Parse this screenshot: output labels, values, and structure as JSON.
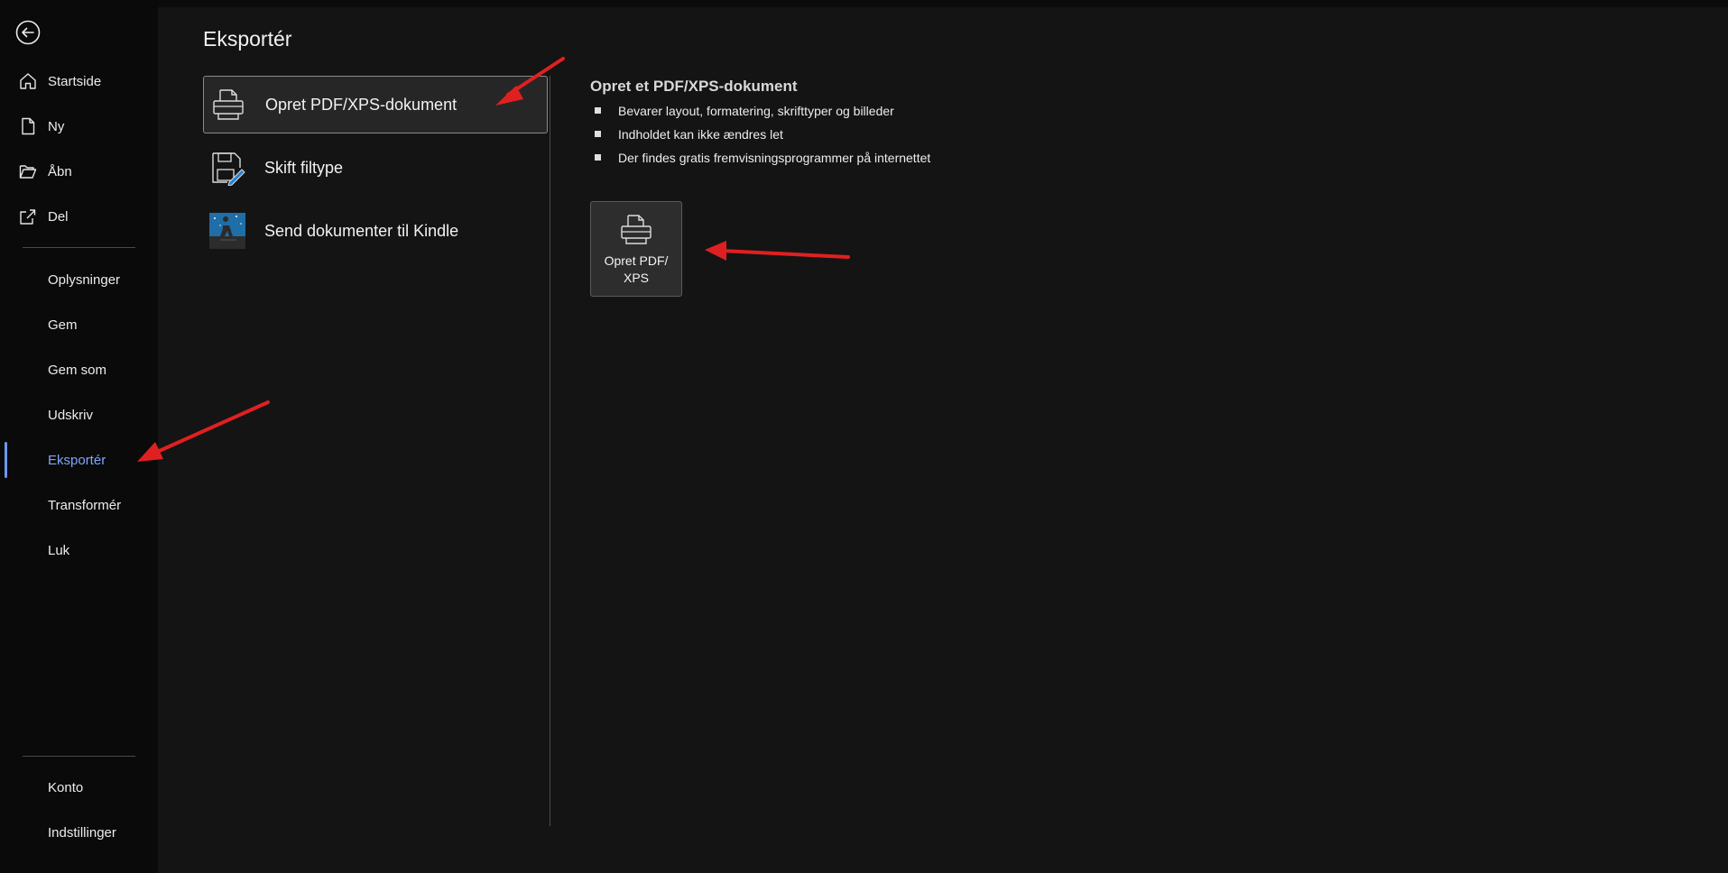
{
  "page": {
    "title": "Eksportér"
  },
  "sidebar": {
    "items": [
      {
        "label": "Startside",
        "icon": "home-icon"
      },
      {
        "label": "Ny",
        "icon": "new-document-icon"
      },
      {
        "label": "Åbn",
        "icon": "folder-open-icon"
      },
      {
        "label": "Del",
        "icon": "share-icon"
      },
      {
        "label": "Oplysninger"
      },
      {
        "label": "Gem"
      },
      {
        "label": "Gem som"
      },
      {
        "label": "Udskriv"
      },
      {
        "label": "Eksportér",
        "active": true
      },
      {
        "label": "Transformér"
      },
      {
        "label": "Luk"
      },
      {
        "label": "Konto"
      },
      {
        "label": "Indstillinger"
      }
    ]
  },
  "export_options": [
    {
      "label": "Opret PDF/XPS-dokument",
      "icon": "pdf-printer-icon",
      "selected": true
    },
    {
      "label": "Skift filtype",
      "icon": "change-file-type-icon"
    },
    {
      "label": "Send dokumenter til Kindle",
      "icon": "kindle-icon"
    }
  ],
  "detail": {
    "title": "Opret et PDF/XPS-dokument",
    "bullets": [
      "Bevarer layout, formatering, skrifttyper og billeder",
      "Indholdet kan ikke ændres let",
      "Der findes gratis fremvisningsprogrammer på internettet"
    ],
    "button_label": "Opret PDF/\nXPS"
  },
  "colors": {
    "accent": "#7ea6ff",
    "annotation_arrow": "#e02020"
  }
}
